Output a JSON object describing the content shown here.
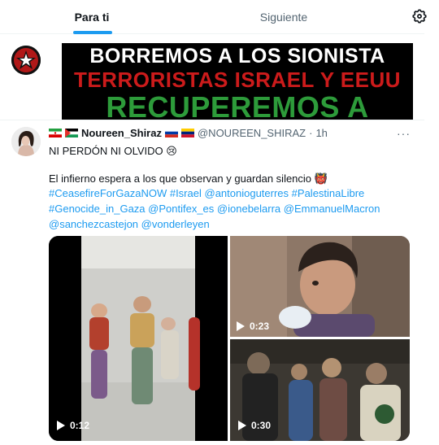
{
  "tabs": {
    "for_you": "Para ti",
    "following": "Siguiente"
  },
  "colors": {
    "accent": "#1d9bf0",
    "muted": "#536471",
    "text": "#0f1419"
  },
  "prev_post": {
    "banner_lines": [
      "BORREMOS A LOS SIONISTA",
      "TERRORISTAS ISRAEL Y EEUU",
      "RECUPEREMOS A"
    ]
  },
  "post": {
    "name": "Noureen_Shiraz",
    "handle": "@NOUREEN_SHIRAZ",
    "separator": "·",
    "time": "1h",
    "more": "···",
    "line1": "NI PERDÓN NI OLVIDO 😢",
    "line2": "El infierno espera a los que observan y guardan silencio 👹",
    "hashtags_mentions": [
      "#CeasefireForGazaNOW",
      "#Israel",
      "@antonioguterres",
      "#PalestinaLibre",
      "#Genocide_in_Gaza",
      "@Pontifex_es",
      "@ionebelarra",
      "@EmmanuelMacron",
      "@sanchezcastejon",
      "@vonderleyen"
    ],
    "media": [
      {
        "duration": "0:12",
        "icon": "play-icon"
      },
      {
        "duration": "0:23",
        "icon": "play-icon"
      },
      {
        "duration": "0:30",
        "icon": "play-icon"
      }
    ]
  }
}
